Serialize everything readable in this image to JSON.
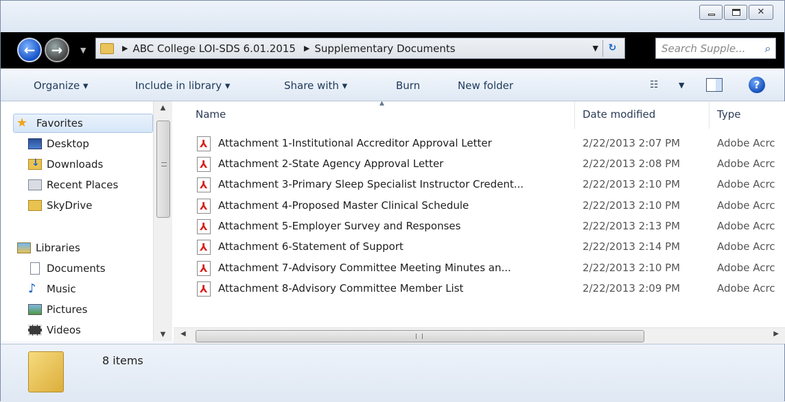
{
  "window": {
    "close_glyph": "✕"
  },
  "nav": {
    "back_arrow": "←",
    "forward_arrow": "→",
    "recent_drop": "▼",
    "breadcrumbs": [
      "ABC College LOI-SDS 6.01.2015",
      "Supplementary Documents"
    ],
    "crumb_separator": "▶",
    "address_drop": "▼",
    "refresh_glyph": "↻",
    "search_placeholder": "Search Supple...",
    "search_icon": "⌕"
  },
  "toolbar": {
    "organize": "Organize ▾",
    "include_in_library": "Include in library ▾",
    "share_with": "Share with ▾",
    "burn": "Burn",
    "new_folder": "New folder",
    "views_icon": "☷",
    "views_drop": "▼",
    "help": "?"
  },
  "navpane": {
    "favorites": "Favorites",
    "star_icon": "★",
    "items": [
      {
        "label": "Desktop"
      },
      {
        "label": "Downloads"
      },
      {
        "label": "Recent Places"
      },
      {
        "label": "SkyDrive"
      }
    ],
    "libraries": "Libraries",
    "library_items": [
      {
        "label": "Documents"
      },
      {
        "label": "Music"
      },
      {
        "label": "Pictures"
      },
      {
        "label": "Videos"
      }
    ],
    "music_icon": "♪",
    "scroll_up": "▲",
    "scroll_down": "▼"
  },
  "filelist": {
    "columns": {
      "name": "Name",
      "date": "Date modified",
      "type": "Type"
    },
    "sort_arrow": "▲",
    "files": [
      {
        "name": "Attachment 1-Institutional Accreditor Approval Letter",
        "date": "2/22/2013 2:07 PM",
        "type": "Adobe Acrc"
      },
      {
        "name": "Attachment 2-State Agency Approval Letter",
        "date": "2/22/2013 2:08 PM",
        "type": "Adobe Acrc"
      },
      {
        "name": "Attachment 3-Primary Sleep Specialist Instructor Credent...",
        "date": "2/22/2013 2:10 PM",
        "type": "Adobe Acrc"
      },
      {
        "name": "Attachment 4-Proposed Master Clinical Schedule",
        "date": "2/22/2013 2:10 PM",
        "type": "Adobe Acrc"
      },
      {
        "name": "Attachment 5-Employer Survey and Responses",
        "date": "2/22/2013 2:13 PM",
        "type": "Adobe Acrc"
      },
      {
        "name": "Attachment 6-Statement of Support",
        "date": "2/22/2013 2:14 PM",
        "type": "Adobe Acrc"
      },
      {
        "name": "Attachment 7-Advisory Committee Meeting Minutes an...",
        "date": "2/22/2013 2:10 PM",
        "type": "Adobe Acrc"
      },
      {
        "name": "Attachment 8-Advisory Committee Member List",
        "date": "2/22/2013 2:09 PM",
        "type": "Adobe Acrc"
      }
    ],
    "hscroll_left": "◀",
    "hscroll_right": "▶"
  },
  "details": {
    "item_count": "8 items"
  }
}
